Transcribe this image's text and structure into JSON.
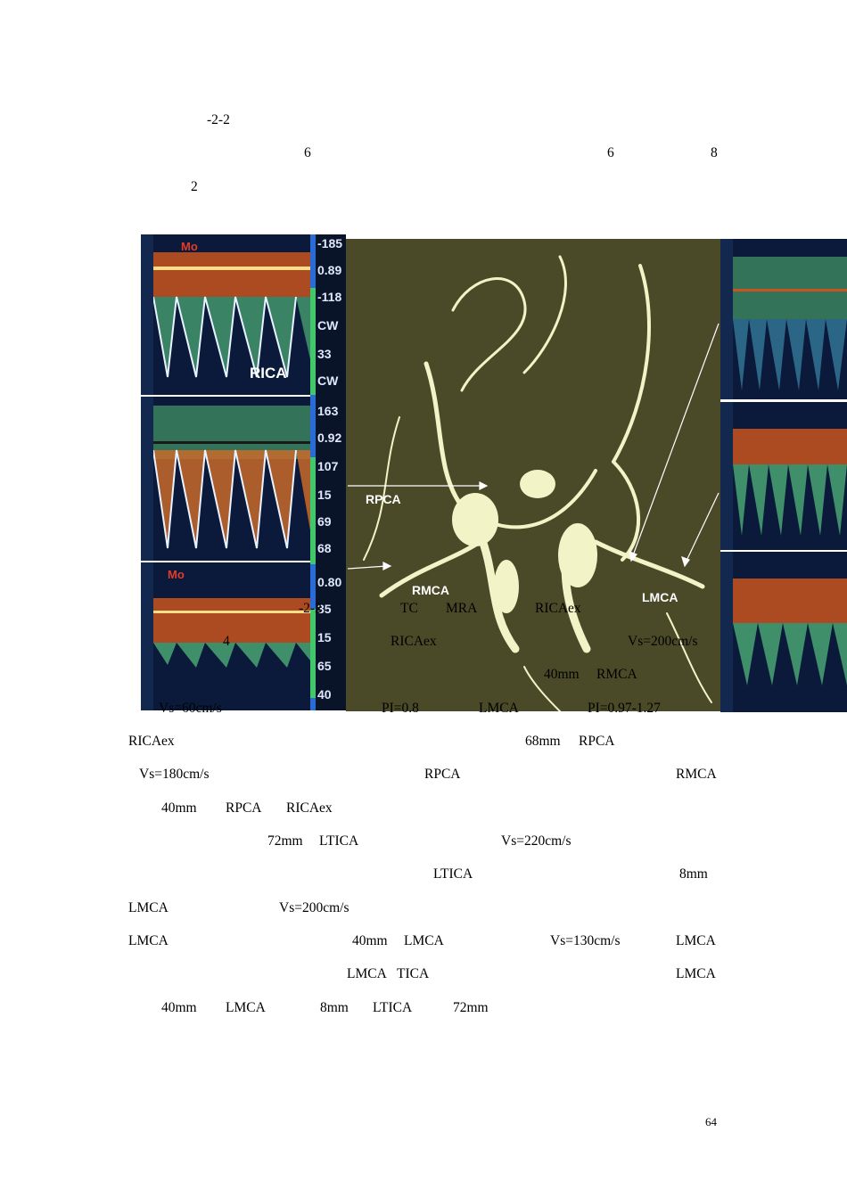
{
  "text": {
    "l1": "-2-2",
    "l2a": "6",
    "l2b": "6",
    "l2c": "8",
    "l3": "2",
    "c1a": "-2-2",
    "c1b": "TC",
    "c1c": "MRA",
    "c1d": "RICAex",
    "c2a": "4",
    "c2b": "RICAex",
    "c2c": "Vs=200cm/s",
    "c3a": "40mm",
    "c3b": "RMCA",
    "c4a": "Vs=60cm/s",
    "c4b": "PI=0.8",
    "c4c": "LMCA",
    "c4d": "PI=0.97-1.27",
    "p1a": "RICAex",
    "p1b": "68mm",
    "p1c": "RPCA",
    "p2a": "Vs=180cm/s",
    "p2b": "RPCA",
    "p2c": "RMCA",
    "p3a": "40mm",
    "p3b": "RPCA",
    "p3c": "RICAex",
    "p4a": "72mm",
    "p4b": "LTICA",
    "p4c": "Vs=220cm/s",
    "p5a": "LTICA",
    "p5b": "8mm",
    "p6a": "LMCA",
    "p6b": "Vs=200cm/s",
    "p7a": "LMCA",
    "p7b": "40mm",
    "p7c": "LMCA",
    "p7d": "Vs=130cm/s",
    "p7e": "LMCA",
    "p8a": "LMCA",
    "p8b": "TICA",
    "p8c": "LMCA",
    "p9a": "40mm",
    "p9b": "LMCA",
    "p9c": "8mm",
    "p9d": "LTICA",
    "p9e": "72mm",
    "page": "64"
  },
  "figure": {
    "mra_labels": {
      "rpca": "RPCA",
      "rmca": "RMCA",
      "lmca": "LMCA"
    },
    "p1": {
      "label": "RICA",
      "mode": "Mo",
      "v1": "-185",
      "v2": "0.89",
      "v3": "-118",
      "v4": "CW",
      "v5": "33",
      "v6": "CW"
    },
    "p2": {
      "v1": "163",
      "v2": "0.92",
      "v3": "107",
      "v4": "15",
      "v5": "69",
      "v6": "68"
    },
    "p3": {
      "mode": "Mo",
      "v1": "0.80",
      "v2": "35",
      "v3": "15",
      "v4": "65",
      "v5": "40"
    },
    "colors": {
      "mra_bg": "#4a4a28",
      "vessel": "#f3f3c8",
      "doppler_bg": "#0b1a3a",
      "arrow": "#ffffff"
    }
  }
}
